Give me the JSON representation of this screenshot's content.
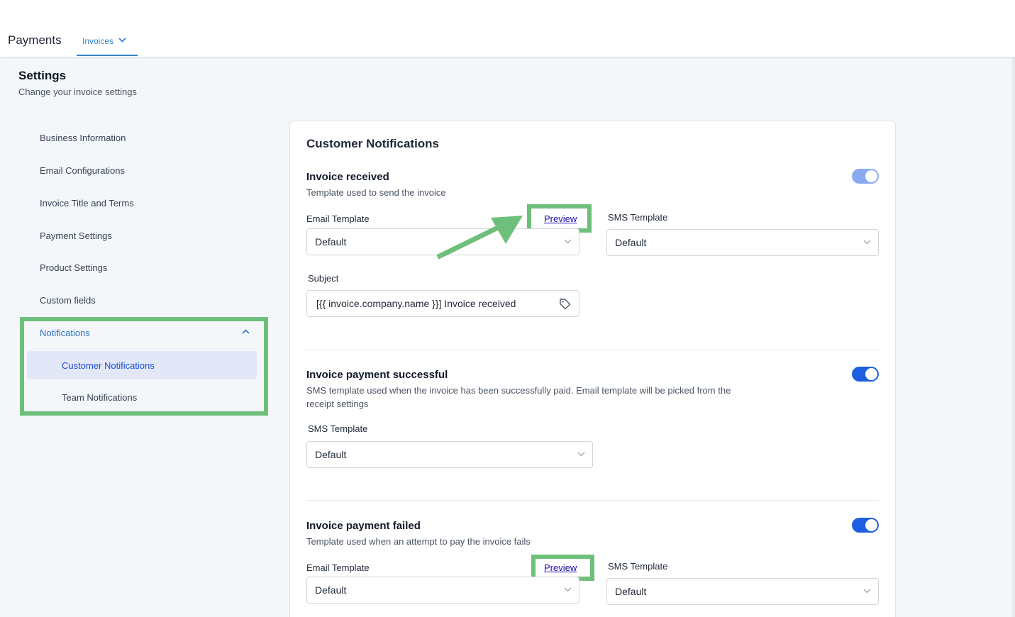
{
  "header": {
    "app_title": "Payments",
    "nav_tab": {
      "label": "Invoices",
      "icon": "chevron-down-icon"
    }
  },
  "page": {
    "title": "Settings",
    "subtitle": "Change your invoice settings"
  },
  "sidebar": {
    "items": [
      {
        "label": "Business Information"
      },
      {
        "label": "Email Configurations"
      },
      {
        "label": "Invoice Title and Terms"
      },
      {
        "label": "Payment Settings"
      },
      {
        "label": "Product Settings"
      },
      {
        "label": "Custom fields"
      }
    ],
    "notifications": {
      "label": "Notifications",
      "expanded": true,
      "icon": "chevron-up-icon",
      "children": [
        {
          "label": "Customer Notifications",
          "active": true
        },
        {
          "label": "Team Notifications",
          "active": false
        }
      ]
    }
  },
  "main": {
    "title": "Customer Notifications",
    "sections": [
      {
        "title": "Invoice received",
        "description": "Template used to send the invoice",
        "enabled": true,
        "email_template_label": "Email Template",
        "email_template_value": "Default",
        "preview_label": "Preview",
        "sms_template_label": "SMS Template",
        "sms_template_value": "Default",
        "subject_label": "Subject",
        "subject_value": "[{{ invoice.company.name }}] Invoice received",
        "subject_icon": "tag-icon"
      },
      {
        "title": "Invoice payment successful",
        "description": "SMS template used when the invoice has been successfully paid. Email template will be picked from the receipt settings",
        "enabled": true,
        "sms_template_label": "SMS Template",
        "sms_template_value": "Default"
      },
      {
        "title": "Invoice payment failed",
        "description": "Template used when an attempt to pay the invoice fails",
        "enabled": true,
        "email_template_label": "Email Template",
        "email_template_value": "Default",
        "preview_label": "Preview",
        "sms_template_label": "SMS Template",
        "sms_template_value": "Default"
      }
    ]
  },
  "colors": {
    "accent": "#1d5fe0",
    "highlight": "#6ebf7a",
    "link": "#1a0dab"
  }
}
